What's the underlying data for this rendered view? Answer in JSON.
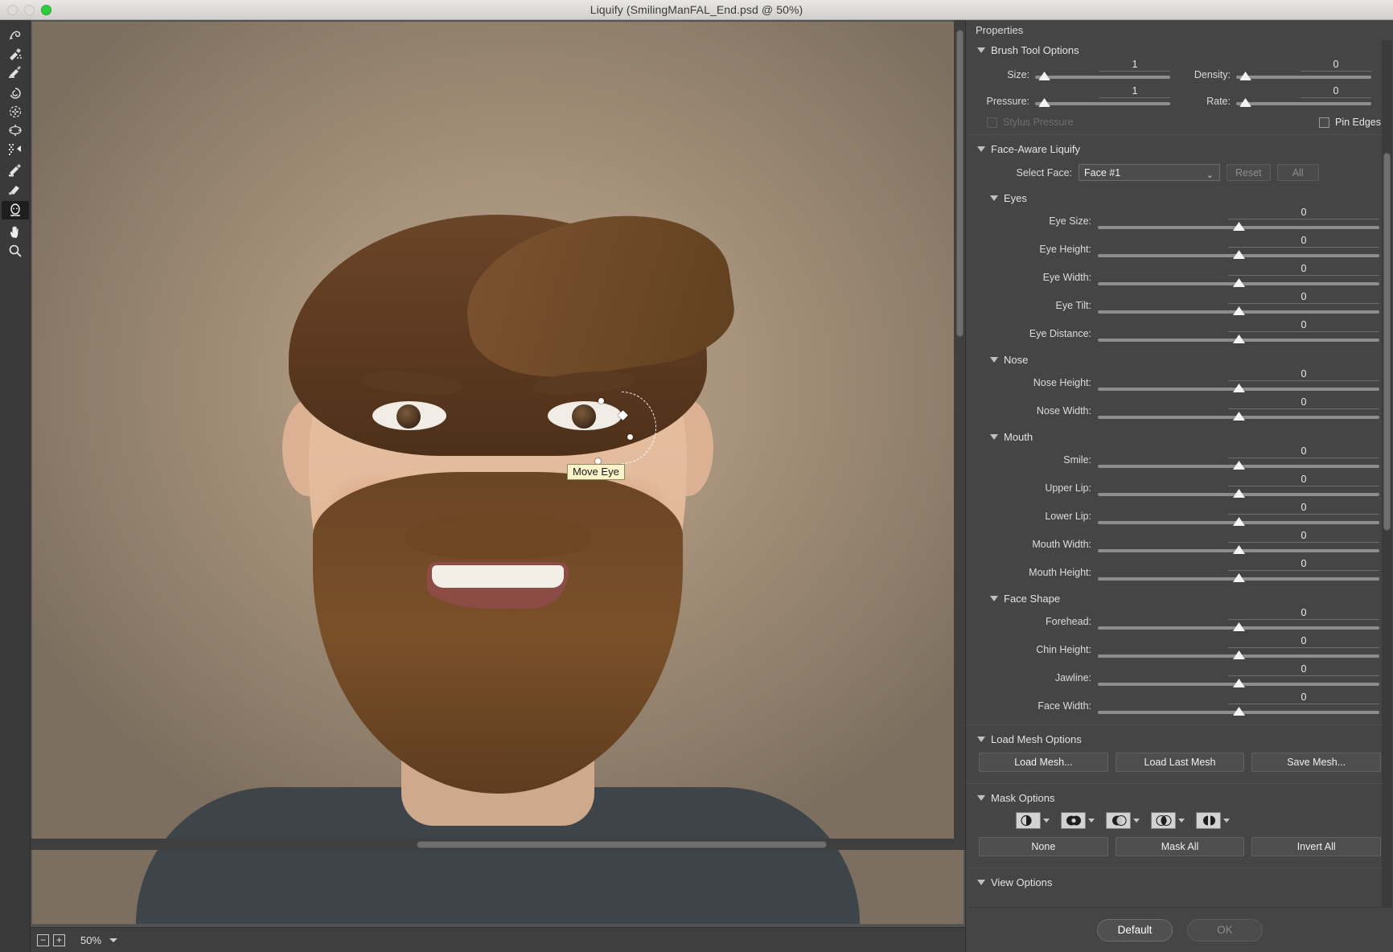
{
  "window": {
    "title": "Liquify (SmilingManFAL_End.psd @ 50%)",
    "controls": {
      "close": "close-button",
      "minimize": "minimize-button",
      "zoom": "zoom-button"
    }
  },
  "toolbar": {
    "tools": [
      {
        "name": "forward-warp-tool",
        "label": "Forward Warp Tool",
        "selected": false
      },
      {
        "name": "reconstruct-tool",
        "label": "Reconstruct Tool",
        "selected": false
      },
      {
        "name": "smooth-tool",
        "label": "Smooth Tool",
        "selected": false
      },
      {
        "name": "twirl-clockwise-tool",
        "label": "Twirl Clockwise Tool",
        "selected": false
      },
      {
        "name": "pucker-tool",
        "label": "Pucker Tool",
        "selected": false
      },
      {
        "name": "bloat-tool",
        "label": "Bloat Tool",
        "selected": false
      },
      {
        "name": "push-left-tool",
        "label": "Push Left Tool",
        "selected": false
      },
      {
        "name": "freeze-mask-tool",
        "label": "Freeze Mask Tool",
        "selected": false
      },
      {
        "name": "thaw-mask-tool",
        "label": "Thaw Mask Tool",
        "selected": false
      },
      {
        "name": "face-tool",
        "label": "Face Tool",
        "selected": true
      },
      {
        "name": "hand-tool",
        "label": "Hand Tool",
        "selected": false
      },
      {
        "name": "zoom-tool",
        "label": "Zoom Tool",
        "selected": false
      }
    ]
  },
  "canvas": {
    "overlay_tooltip": "Move Eye",
    "status": {
      "zoom_out": "−",
      "zoom_in": "+",
      "zoom_level": "50%"
    }
  },
  "properties": {
    "header": "Properties",
    "brush_tool_options": {
      "title": "Brush Tool Options",
      "fields": [
        {
          "label": "Size:",
          "value": "1"
        },
        {
          "label": "Density:",
          "value": "0"
        },
        {
          "label": "Pressure:",
          "value": "1"
        },
        {
          "label": "Rate:",
          "value": "0"
        }
      ],
      "stylus_pressure": {
        "label": "Stylus Pressure",
        "checked": false,
        "disabled": true
      },
      "pin_edges": {
        "label": "Pin Edges",
        "checked": false,
        "disabled": false
      }
    },
    "face_aware_liquify": {
      "title": "Face-Aware Liquify",
      "select_face_label": "Select Face:",
      "select_face_value": "Face #1",
      "reset_label": "Reset",
      "all_label": "All",
      "groups": [
        {
          "title": "Eyes",
          "sliders": [
            {
              "label": "Eye Size:",
              "value": "0"
            },
            {
              "label": "Eye Height:",
              "value": "0"
            },
            {
              "label": "Eye Width:",
              "value": "0"
            },
            {
              "label": "Eye Tilt:",
              "value": "0"
            },
            {
              "label": "Eye Distance:",
              "value": "0"
            }
          ]
        },
        {
          "title": "Nose",
          "sliders": [
            {
              "label": "Nose Height:",
              "value": "0"
            },
            {
              "label": "Nose Width:",
              "value": "0"
            }
          ]
        },
        {
          "title": "Mouth",
          "sliders": [
            {
              "label": "Smile:",
              "value": "0"
            },
            {
              "label": "Upper Lip:",
              "value": "0"
            },
            {
              "label": "Lower Lip:",
              "value": "0"
            },
            {
              "label": "Mouth Width:",
              "value": "0"
            },
            {
              "label": "Mouth Height:",
              "value": "0"
            }
          ]
        },
        {
          "title": "Face Shape",
          "sliders": [
            {
              "label": "Forehead:",
              "value": "0"
            },
            {
              "label": "Chin Height:",
              "value": "0"
            },
            {
              "label": "Jawline:",
              "value": "0"
            },
            {
              "label": "Face Width:",
              "value": "0"
            }
          ]
        }
      ]
    },
    "load_mesh_options": {
      "title": "Load Mesh Options",
      "buttons": [
        "Load Mesh...",
        "Load Last Mesh",
        "Save Mesh..."
      ]
    },
    "mask_options": {
      "title": "Mask Options",
      "icons": [
        "replace-selection-icon",
        "add-to-selection-icon",
        "subtract-from-selection-icon",
        "intersect-with-selection-icon",
        "invert-selection-icon"
      ],
      "buttons": [
        "None",
        "Mask All",
        "Invert All"
      ]
    },
    "view_options": {
      "title": "View Options"
    },
    "footer": {
      "default_label": "Default",
      "ok_label": "OK"
    }
  },
  "colors": {
    "panel_bg": "#454545",
    "titlebar_bg": "#dedcd9",
    "accent_green": "#2fcc41",
    "tooltip_bg": "#faf3c8",
    "slider_track": "#8d8d8d"
  }
}
